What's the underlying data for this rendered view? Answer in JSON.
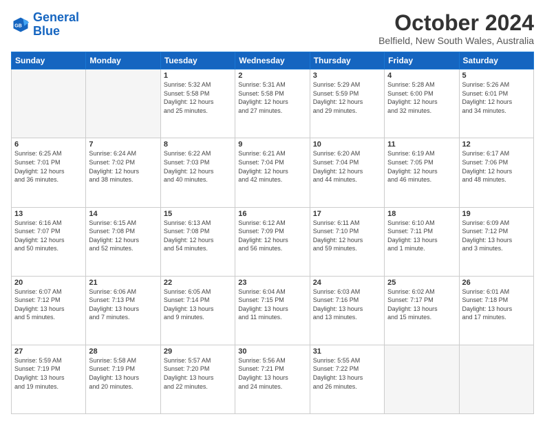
{
  "header": {
    "logo_line1": "General",
    "logo_line2": "Blue",
    "title": "October 2024",
    "subtitle": "Belfield, New South Wales, Australia"
  },
  "weekdays": [
    "Sunday",
    "Monday",
    "Tuesday",
    "Wednesday",
    "Thursday",
    "Friday",
    "Saturday"
  ],
  "weeks": [
    [
      {
        "day": "",
        "info": ""
      },
      {
        "day": "",
        "info": ""
      },
      {
        "day": "1",
        "info": "Sunrise: 5:32 AM\nSunset: 5:58 PM\nDaylight: 12 hours\nand 25 minutes."
      },
      {
        "day": "2",
        "info": "Sunrise: 5:31 AM\nSunset: 5:58 PM\nDaylight: 12 hours\nand 27 minutes."
      },
      {
        "day": "3",
        "info": "Sunrise: 5:29 AM\nSunset: 5:59 PM\nDaylight: 12 hours\nand 29 minutes."
      },
      {
        "day": "4",
        "info": "Sunrise: 5:28 AM\nSunset: 6:00 PM\nDaylight: 12 hours\nand 32 minutes."
      },
      {
        "day": "5",
        "info": "Sunrise: 5:26 AM\nSunset: 6:01 PM\nDaylight: 12 hours\nand 34 minutes."
      }
    ],
    [
      {
        "day": "6",
        "info": "Sunrise: 6:25 AM\nSunset: 7:01 PM\nDaylight: 12 hours\nand 36 minutes."
      },
      {
        "day": "7",
        "info": "Sunrise: 6:24 AM\nSunset: 7:02 PM\nDaylight: 12 hours\nand 38 minutes."
      },
      {
        "day": "8",
        "info": "Sunrise: 6:22 AM\nSunset: 7:03 PM\nDaylight: 12 hours\nand 40 minutes."
      },
      {
        "day": "9",
        "info": "Sunrise: 6:21 AM\nSunset: 7:04 PM\nDaylight: 12 hours\nand 42 minutes."
      },
      {
        "day": "10",
        "info": "Sunrise: 6:20 AM\nSunset: 7:04 PM\nDaylight: 12 hours\nand 44 minutes."
      },
      {
        "day": "11",
        "info": "Sunrise: 6:19 AM\nSunset: 7:05 PM\nDaylight: 12 hours\nand 46 minutes."
      },
      {
        "day": "12",
        "info": "Sunrise: 6:17 AM\nSunset: 7:06 PM\nDaylight: 12 hours\nand 48 minutes."
      }
    ],
    [
      {
        "day": "13",
        "info": "Sunrise: 6:16 AM\nSunset: 7:07 PM\nDaylight: 12 hours\nand 50 minutes."
      },
      {
        "day": "14",
        "info": "Sunrise: 6:15 AM\nSunset: 7:08 PM\nDaylight: 12 hours\nand 52 minutes."
      },
      {
        "day": "15",
        "info": "Sunrise: 6:13 AM\nSunset: 7:08 PM\nDaylight: 12 hours\nand 54 minutes."
      },
      {
        "day": "16",
        "info": "Sunrise: 6:12 AM\nSunset: 7:09 PM\nDaylight: 12 hours\nand 56 minutes."
      },
      {
        "day": "17",
        "info": "Sunrise: 6:11 AM\nSunset: 7:10 PM\nDaylight: 12 hours\nand 59 minutes."
      },
      {
        "day": "18",
        "info": "Sunrise: 6:10 AM\nSunset: 7:11 PM\nDaylight: 13 hours\nand 1 minute."
      },
      {
        "day": "19",
        "info": "Sunrise: 6:09 AM\nSunset: 7:12 PM\nDaylight: 13 hours\nand 3 minutes."
      }
    ],
    [
      {
        "day": "20",
        "info": "Sunrise: 6:07 AM\nSunset: 7:12 PM\nDaylight: 13 hours\nand 5 minutes."
      },
      {
        "day": "21",
        "info": "Sunrise: 6:06 AM\nSunset: 7:13 PM\nDaylight: 13 hours\nand 7 minutes."
      },
      {
        "day": "22",
        "info": "Sunrise: 6:05 AM\nSunset: 7:14 PM\nDaylight: 13 hours\nand 9 minutes."
      },
      {
        "day": "23",
        "info": "Sunrise: 6:04 AM\nSunset: 7:15 PM\nDaylight: 13 hours\nand 11 minutes."
      },
      {
        "day": "24",
        "info": "Sunrise: 6:03 AM\nSunset: 7:16 PM\nDaylight: 13 hours\nand 13 minutes."
      },
      {
        "day": "25",
        "info": "Sunrise: 6:02 AM\nSunset: 7:17 PM\nDaylight: 13 hours\nand 15 minutes."
      },
      {
        "day": "26",
        "info": "Sunrise: 6:01 AM\nSunset: 7:18 PM\nDaylight: 13 hours\nand 17 minutes."
      }
    ],
    [
      {
        "day": "27",
        "info": "Sunrise: 5:59 AM\nSunset: 7:19 PM\nDaylight: 13 hours\nand 19 minutes."
      },
      {
        "day": "28",
        "info": "Sunrise: 5:58 AM\nSunset: 7:19 PM\nDaylight: 13 hours\nand 20 minutes."
      },
      {
        "day": "29",
        "info": "Sunrise: 5:57 AM\nSunset: 7:20 PM\nDaylight: 13 hours\nand 22 minutes."
      },
      {
        "day": "30",
        "info": "Sunrise: 5:56 AM\nSunset: 7:21 PM\nDaylight: 13 hours\nand 24 minutes."
      },
      {
        "day": "31",
        "info": "Sunrise: 5:55 AM\nSunset: 7:22 PM\nDaylight: 13 hours\nand 26 minutes."
      },
      {
        "day": "",
        "info": ""
      },
      {
        "day": "",
        "info": ""
      }
    ]
  ]
}
